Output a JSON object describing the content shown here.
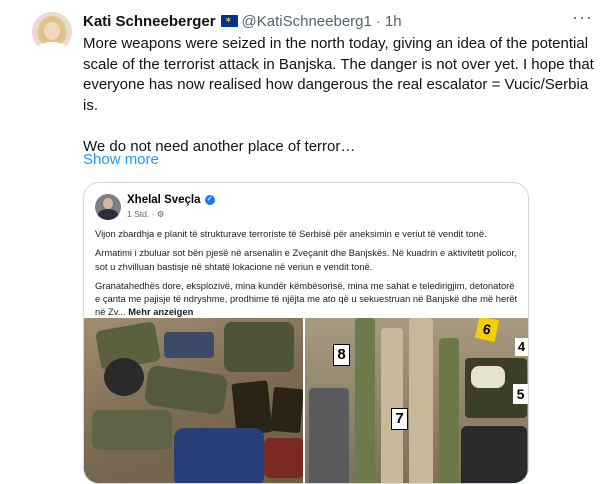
{
  "author": {
    "name": "Kati Schneeberger",
    "handle": "@KatiSchneeberg1",
    "separator": "·",
    "time": "1h",
    "flag_icon": "eu-flag-icon",
    "verified_icon": "verified-badge-icon"
  },
  "menu": {
    "icon": "more-options-icon",
    "label": "···"
  },
  "body": {
    "paragraph_1": "More weapons were seized in the north today, giving an idea of the potential scale of the terrorist attack in Banjska. The danger is not over yet. I hope that everyone has now realised how dangerous the real escalator = Vucic/Serbia is.",
    "paragraph_2": "We do not need another place of terror…",
    "show_more": "Show more"
  },
  "embedded_post": {
    "author": "Xhelal Sveçla",
    "meta": "1 Std. · ⚙",
    "paragraph_1": "Vijon zbardhja e planit të strukturave terroriste të Serbisë për aneksimin e veriut të vendit tonë.",
    "paragraph_2": "Armatimi i zbuluar sot bën pjesë në arsenalin e Zveçanit dhe Banjskës. Në kuadrin e aktivitetit policor, sot u zhvilluan bastisje në shtatë lokacione në veriun e vendit tonë.",
    "paragraph_3": "Granatahedhës dore, eksplozivë, mina kundër këmbësorisë, mina me sahat e teledirigjim, detonatorë e çanta me pajisje të ndryshme, prodhime të njëjta me ato që u sekuestruan në Banjskë dhe më herët në Zv...",
    "more_label": "Mehr anzeigen",
    "evidence_tags": [
      "8",
      "7",
      "6",
      "4",
      "5"
    ]
  },
  "colors": {
    "accent": "#1d9bf0",
    "text_primary": "#0f1419",
    "text_secondary": "#536471",
    "border": "#cfd9de",
    "eu_blue": "#003399",
    "evidence_tag_yellow": "#f5d000"
  }
}
